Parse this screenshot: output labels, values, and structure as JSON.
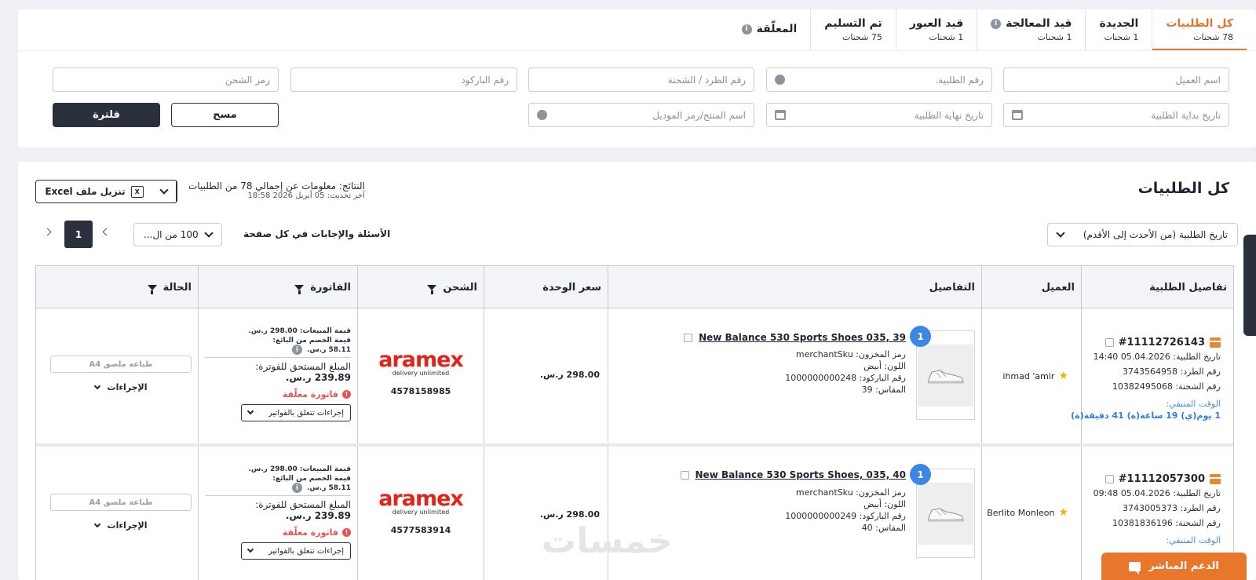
{
  "tabs": [
    {
      "label": "كل الطلبيات",
      "count": "78 شحنات",
      "active": true,
      "info": false
    },
    {
      "label": "الجديدة",
      "count": "1 شحنات",
      "active": false,
      "info": false
    },
    {
      "label": "قيد المعالجة",
      "count": "1 شحنات",
      "active": false,
      "info": true
    },
    {
      "label": "قيد العبور",
      "count": "1 شحنات",
      "active": false,
      "info": false
    },
    {
      "label": "تم التسليم",
      "count": "75 شحنات",
      "active": false,
      "info": false
    },
    {
      "label": "المعلّقة",
      "count": "",
      "active": false,
      "info": true
    }
  ],
  "filters": {
    "customer_name": "اسم العميل",
    "order_number": "رقم الطلبية.",
    "package_number": "رقم الطرد / الشحنة",
    "barcode": "رقم الباركود",
    "shipping_code": "رمز الشحن",
    "start_date": "تاريخ بداية الطلبية",
    "end_date": "تاريخ نهاية الطلبية",
    "product_name": "اسم المنتج/رمز الموديل",
    "clear_label": "مسح",
    "filter_label": "فلترة"
  },
  "results": {
    "title": "كل الطلبيات",
    "summary": "النتائج: معلومات عن إجمالي 78 من الطلبيات",
    "updated": "آخر تحديث: 05 أبريل 2026 18:58",
    "excel_label": "تنزيل ملف Excel",
    "sort_value": "تاريخ الطلبية (من الأحدث إلى الأقدم)",
    "per_page_label": "الأسئلة والإجابات في كل صفحة",
    "per_page_value": "100 من ال...",
    "current_page": "1"
  },
  "columns": {
    "order": "تفاصيل الطلبية",
    "client": "العميل",
    "details": "التفاصيل",
    "price": "سعر الوحدة",
    "shipping": "الشحن",
    "invoice": "الفاتورة",
    "status": "الحالة"
  },
  "orders": [
    {
      "id": "#11112726143",
      "date": "تاريخ الطلبية: 05.04.2026 14:40",
      "package": "رقم الطرد: 3743564958",
      "shipment": "رقم الشحنة: 10382495068",
      "remain_label": "الوقت المتبقي:",
      "remain": "1 يوم(ي) 19 ساعة(ة) 41 دقيقة(ة)",
      "client": "ihmad 'amir",
      "qty": "1",
      "product": "New Balance 530 Sports Shoes 035, 39",
      "sku": "رمز المخزون: merchantSku",
      "color": "اللون: أبيض",
      "barcode": "رقم الباركود: 1000000000248",
      "size": "المقاس: 39",
      "price": "298.00 ر.س.",
      "carrier": "aramex",
      "carrier_tag": "delivery unlimited",
      "awb": "4578158985",
      "sales_value": "قيمة المبيعات: 298.00 ر.س.",
      "discount_label": "قيمة الخصم من البائع:",
      "discount_value": "58.11 ر.س.",
      "due_label": "المبلغ المستحق للفوترة:",
      "due_value": "239.89 ر.س.",
      "invoice_status": "فاتورة معلّقة",
      "invoice_actions": "إجراءات تتعلق بالفواتير",
      "print_label": "طباعة ملصق A4",
      "actions_label": "الإجراءات"
    },
    {
      "id": "#11112057300",
      "date": "تاريخ الطلبية: 05.04.2026 09:48",
      "package": "رقم الطرد: 3743005373",
      "shipment": "رقم الشحنة: 10381836196",
      "remain_label": "الوقت المتبقي:",
      "remain": "",
      "client": "Berlito Monleon",
      "qty": "1",
      "product": "New Balance 530 Sports Shoes, 035, 40",
      "sku": "رمز المخزون: merchantSku",
      "color": "اللون: أبيض",
      "barcode": "رقم الباركود: 1000000000249",
      "size": "المقاس: 40",
      "price": "298.00 ر.س.",
      "carrier": "aramex",
      "carrier_tag": "delivery unlimited",
      "awb": "4577583914",
      "sales_value": "قيمة المبيعات: 298.00 ر.س.",
      "discount_label": "قيمة الخصم من البائع:",
      "discount_value": "58.11 ر.س.",
      "due_label": "المبلغ المستحق للفوترة:",
      "due_value": "239.89 ر.س.",
      "invoice_status": "فاتورة معلّقة",
      "invoice_actions": "إجراءات تتعلق بالفواتير",
      "print_label": "طباعة ملصق A4",
      "actions_label": "الإجراءات"
    }
  ],
  "support_label": "الدعم المباشر",
  "watermark": "خمسات",
  "colors": {
    "accent": "#e0772b",
    "dark": "#2a303c",
    "link": "#2f7de1",
    "danger": "#e45252",
    "aramex": "#e1251b"
  }
}
